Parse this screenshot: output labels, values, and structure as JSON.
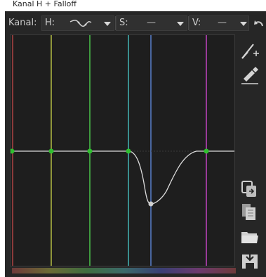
{
  "window": {
    "title": "Kanal H + Falloff"
  },
  "toolbar": {
    "channel_label": "Kanal:",
    "h_label": "H:",
    "s_label": "S:",
    "s_value": "—",
    "v_label": "V:",
    "v_value": "—"
  },
  "curve": {
    "marker_count": 6,
    "colors": {
      "line_red": "#8a3a3a",
      "line_yellow": "#8f963a",
      "line_green": "#3f9a3f",
      "line_cyan": "#3a8f8f",
      "line_blue": "#4a67a0",
      "line_magenta": "#9a3a9a",
      "curve": "#dcdcdc",
      "control_point_green": "#2fbf2f",
      "control_point_gray": "#cfcfcf"
    }
  },
  "side_toolbar": {
    "icons": [
      "curve-edit-points-icon",
      "pipette-icon",
      "copy-icon",
      "paste-icon",
      "open-folder-icon",
      "save-icon"
    ]
  }
}
